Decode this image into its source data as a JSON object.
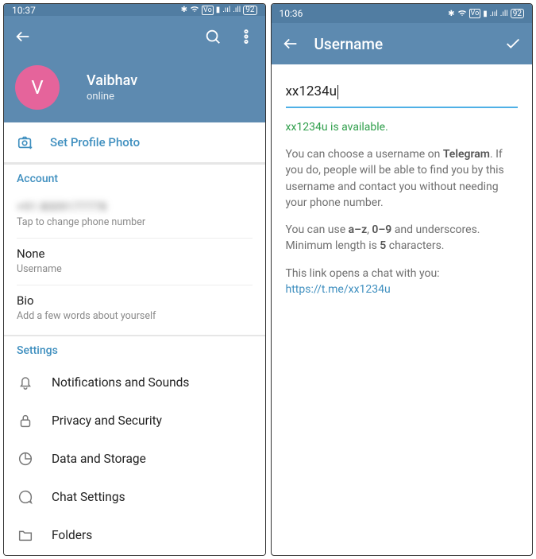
{
  "left": {
    "status": {
      "time": "10:37",
      "battery": "92"
    },
    "profile": {
      "avatar_initial": "V",
      "name": "Vaibhav",
      "status": "online"
    },
    "set_photo": "Set Profile Photo",
    "account": {
      "title": "Account",
      "phone_value": "+91 8009177778",
      "phone_hint": "Tap to change phone number",
      "username_value": "None",
      "username_hint": "Username",
      "bio_value": "Bio",
      "bio_hint": "Add a few words about yourself"
    },
    "settings": {
      "title": "Settings",
      "items": [
        {
          "label": "Notifications and Sounds"
        },
        {
          "label": "Privacy and Security"
        },
        {
          "label": "Data and Storage"
        },
        {
          "label": "Chat Settings"
        },
        {
          "label": "Folders"
        }
      ]
    }
  },
  "right": {
    "status": {
      "time": "10:36",
      "battery": "92"
    },
    "header_title": "Username",
    "input_value": "xx1234u",
    "availability": "xx1234u is available.",
    "para1_a": "You can choose a username on ",
    "para1_bold": "Telegram",
    "para1_b": ". If you do, people will be able to find you by this username and contact you without needing your phone number.",
    "para2_a": "You can use ",
    "para2_b1": "a–z",
    "para2_m1": ", ",
    "para2_b2": "0–9",
    "para2_m2": " and underscores. Minimum length is ",
    "para2_b3": "5",
    "para2_c": " characters.",
    "para3": "This link opens a chat with you:",
    "link": "https://t.me/xx1234u"
  }
}
